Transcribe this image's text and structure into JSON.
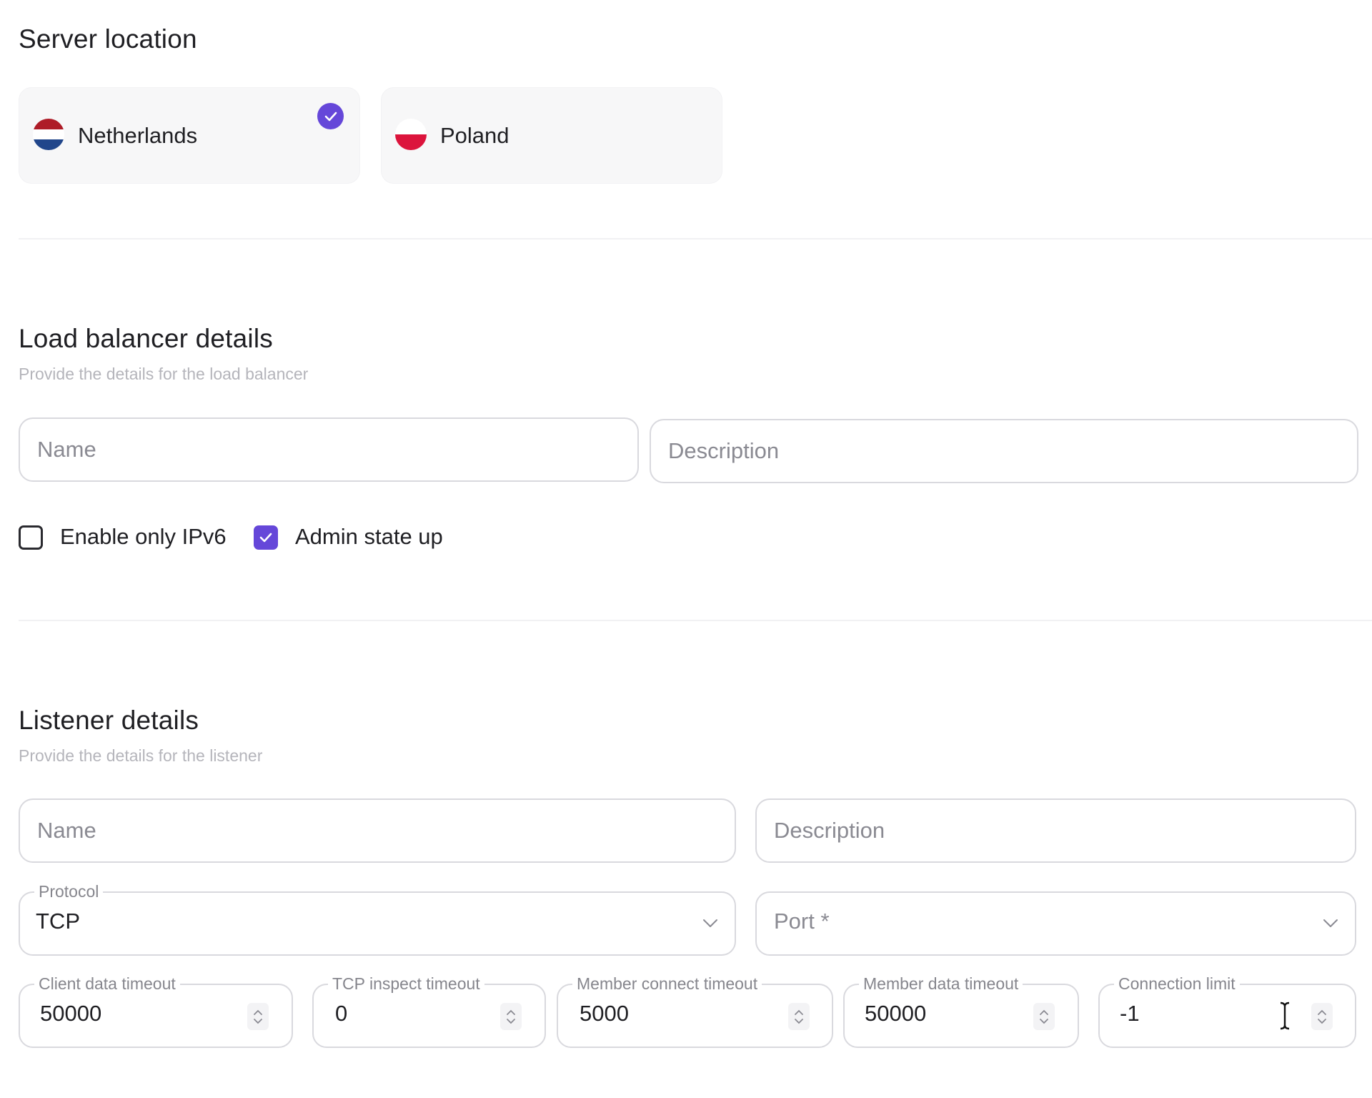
{
  "server_location": {
    "title": "Server location",
    "options": [
      {
        "label": "Netherlands",
        "selected": true
      },
      {
        "label": "Poland",
        "selected": false
      }
    ]
  },
  "load_balancer": {
    "title": "Load balancer details",
    "subtitle": "Provide the details for the load balancer",
    "name_placeholder": "Name",
    "description_placeholder": "Description",
    "ipv6_label": "Enable only IPv6",
    "ipv6_checked": false,
    "admin_state_label": "Admin state up",
    "admin_state_checked": true
  },
  "listener": {
    "title": "Listener details",
    "subtitle": "Provide the details for the listener",
    "name_placeholder": "Name",
    "description_placeholder": "Description",
    "protocol_label": "Protocol",
    "protocol_value": "TCP",
    "port_placeholder": "Port *",
    "timeouts": [
      {
        "label": "Client data timeout",
        "value": "50000"
      },
      {
        "label": "TCP inspect timeout",
        "value": "0"
      },
      {
        "label": "Member connect timeout",
        "value": "5000"
      },
      {
        "label": "Member data timeout",
        "value": "50000"
      },
      {
        "label": "Connection limit",
        "value": "-1"
      }
    ]
  },
  "colors": {
    "accent": "#6547d9",
    "border": "#d9d9de",
    "muted_text": "#b5b5bb"
  }
}
